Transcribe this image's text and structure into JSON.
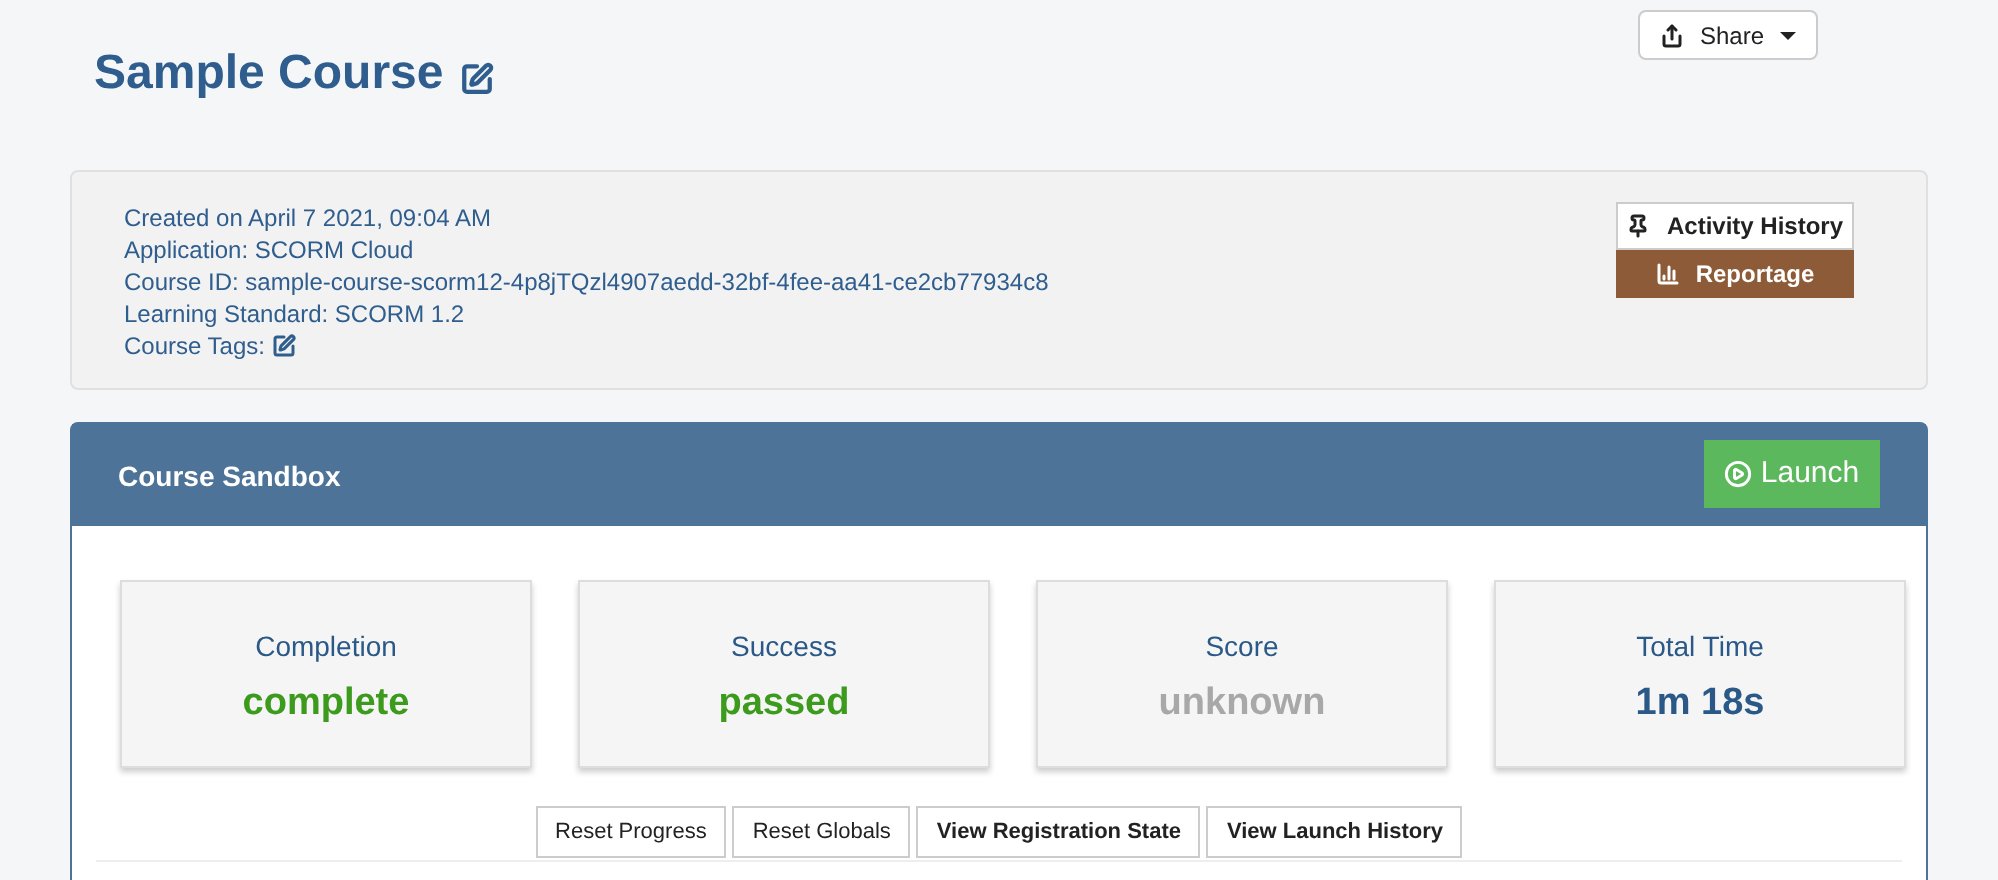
{
  "title": "Sample Course",
  "share": {
    "label": "Share"
  },
  "info": [
    "Created on April 7 2021, 09:04 AM",
    "Application: SCORM Cloud",
    "Course ID: sample-course-scorm12-4p8jTQzl4907aedd-32bf-4fee-aa41-ce2cb77934c8",
    "Learning Standard: SCORM 1.2"
  ],
  "tags_label": "Course Tags:",
  "side_buttons": [
    {
      "label": "Activity History",
      "kind": "pin"
    },
    {
      "label": "Reportage",
      "kind": "chart"
    }
  ],
  "sandbox": {
    "title": "Course Sandbox",
    "launch": "Launch",
    "stats": [
      {
        "label": "Completion",
        "value": "complete",
        "color": "#3c9a1d"
      },
      {
        "label": "Success",
        "value": "passed",
        "color": "#3c9a1d"
      },
      {
        "label": "Score",
        "value": "unknown",
        "color": "#a8a8a8"
      },
      {
        "label": "Total Time",
        "value": "1m 18s",
        "color": "#2a5887"
      }
    ],
    "actions": [
      {
        "label": "Reset Progress",
        "kind": "plain"
      },
      {
        "label": "Reset Globals",
        "kind": "plain"
      },
      {
        "label": "View Registration State",
        "kind": "strong"
      },
      {
        "label": "View Launch History",
        "kind": "strong"
      }
    ]
  }
}
